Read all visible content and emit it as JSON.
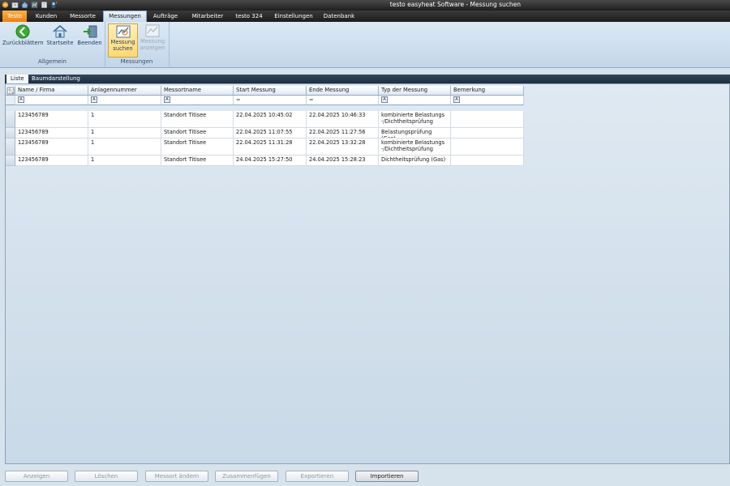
{
  "window": {
    "title": "testo easyheat Software - Messung suchen"
  },
  "menu": {
    "tabs": [
      {
        "label": "Testo"
      },
      {
        "label": "Kunden"
      },
      {
        "label": "Messorte"
      },
      {
        "label": "Messungen"
      },
      {
        "label": "Aufträge"
      },
      {
        "label": "Mitarbeiter"
      },
      {
        "label": "testo 324"
      },
      {
        "label": "Einstellungen"
      },
      {
        "label": "Datenbank"
      }
    ]
  },
  "ribbon": {
    "groups": [
      {
        "title": "Allgemein",
        "buttons": [
          {
            "label": "Zurückblättern"
          },
          {
            "label": "Startseite"
          },
          {
            "label": "Beenden"
          }
        ]
      },
      {
        "title": "Messungen",
        "buttons": [
          {
            "label": "Messung suchen"
          },
          {
            "label": "Messung anzeigen"
          }
        ]
      }
    ]
  },
  "view_tabs": [
    {
      "label": "Liste"
    },
    {
      "label": "Baumdarstellung"
    }
  ],
  "table": {
    "columns": [
      "Name / Firma",
      "Anlagennummer",
      "Messortname",
      "Start Messung",
      "Ende Messung",
      "Typ der Messung",
      "Bemerkung"
    ],
    "filters": [
      "A",
      "A",
      "A",
      "=",
      "=",
      "A",
      "A"
    ],
    "rows": [
      {
        "name": "123456789",
        "anlage": "1",
        "ort": "Standort Titisee",
        "start": "22.04.2025 10:45:02",
        "ende": "22.04.2025 10:46:33",
        "typ": "kombinierte Belastungs -/Dichtheitsprüfung",
        "bemerkung": ""
      },
      {
        "name": "123456789",
        "anlage": "1",
        "ort": "Standort Titisee",
        "start": "22.04.2025 11:07:55",
        "ende": "22.04.2025 11:27:56",
        "typ": "Belastungsprüfung (Gas)",
        "bemerkung": ""
      },
      {
        "name": "123456789",
        "anlage": "1",
        "ort": "Standort Titisee",
        "start": "22.04.2025 11:31:28",
        "ende": "22.04.2025 13:32:28",
        "typ": "kombinierte Belastungs -/Dichtheitsprüfung",
        "bemerkung": ""
      },
      {
        "name": "123456789",
        "anlage": "1",
        "ort": "Standort Titisee",
        "start": "24.04.2025 15:27:50",
        "ende": "24.04.2025 15:28:23",
        "typ": "Dichtheitsprüfung (Gas)",
        "bemerkung": ""
      }
    ]
  },
  "bottom_buttons": [
    {
      "label": "Anzeigen"
    },
    {
      "label": "Löschen"
    },
    {
      "label": "Messort ändern"
    },
    {
      "label": "Zusammenfügen"
    },
    {
      "label": "Exportieren"
    },
    {
      "label": "Importieren"
    }
  ]
}
